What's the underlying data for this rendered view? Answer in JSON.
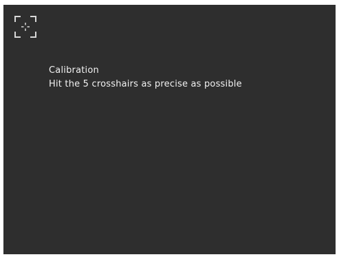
{
  "icon": {
    "name": "calibration-crosshair-icon",
    "color": "#d9d9d9"
  },
  "calibration": {
    "title": "Calibration",
    "instruction": "Hit the 5 crosshairs as precise as possible"
  },
  "colors": {
    "background": "#2e2e2e",
    "text": "#f2f2f2"
  }
}
